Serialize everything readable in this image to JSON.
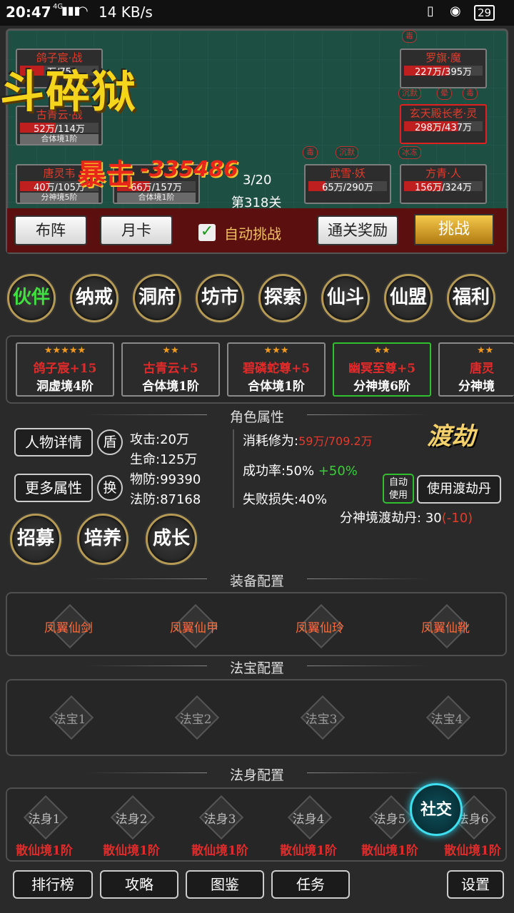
{
  "status": {
    "time": "20:47",
    "net": "4G",
    "speed": "14 KB/s",
    "battery": "29"
  },
  "battle": {
    "title": "斗碎狱",
    "crit_label": "暴击",
    "crit_value": "-335486",
    "wave": "3/20",
    "level": "第318关",
    "allies": [
      {
        "name": "鸽子宸·战",
        "hp": "万/75",
        "lv": "",
        "fill": 0.3
      },
      {
        "name": "古青云·战",
        "hp": "52万/114万",
        "lv": "合体境1阶",
        "fill": 0.45
      },
      {
        "name": "唐灵韦",
        "hp": "40万/105万",
        "lv": "分神境5阶",
        "fill": 0.38
      },
      {
        "name": "",
        "hp": "66万/157万",
        "lv": "合体境1阶",
        "fill": 0.42
      }
    ],
    "enemies": [
      {
        "name": "罗旗·魔",
        "hp": "227万/395万",
        "lv": "",
        "fill": 0.57
      },
      {
        "name": "玄天殿长老·灵",
        "hp": "298万/437万",
        "lv": "",
        "fill": 0.68
      },
      {
        "name": "武雪·妖",
        "hp": "65万/290万",
        "lv": "",
        "fill": 0.22
      },
      {
        "name": "方青·人",
        "hp": "156万/324万",
        "lv": "",
        "fill": 0.48
      }
    ],
    "tags": {
      "poison": "毒",
      "silence": "沉默",
      "stun": "晕",
      "freeze": "冰冻"
    }
  },
  "controls": {
    "formation": "布阵",
    "monthly": "月卡",
    "auto_label": "自动挑战",
    "clear_reward": "通关奖励",
    "challenge": "挑战"
  },
  "nav": [
    "伙伴",
    "纳戒",
    "洞府",
    "坊市",
    "探索",
    "仙斗",
    "仙盟",
    "福利"
  ],
  "partners": [
    {
      "stars": "★★★★★",
      "name": "鸽子宸+15",
      "level": "洞虚境4阶"
    },
    {
      "stars": "★★",
      "name": "古青云+5",
      "level": "合体境1阶"
    },
    {
      "stars": "★★★",
      "name": "碧磷蛇尊+5",
      "level": "合体境1阶"
    },
    {
      "stars": "★★",
      "name": "幽冥至尊+5",
      "level": "分神境6阶"
    },
    {
      "stars": "★★",
      "name": "唐灵",
      "level": "分神境"
    }
  ],
  "attrs": {
    "title": "角色属性",
    "detail_btn": "人物详情",
    "shield_btn": "盾",
    "more_btn": "更多属性",
    "swap_btn": "换",
    "atk": "攻击:20万",
    "hp": "生命:125万",
    "pdef": "物防:99390",
    "mdef": "法防:87168",
    "cost_label": "消耗修为:",
    "cost_value": "59万/709.2万",
    "rate_label": "成功率:50%",
    "rate_bonus": "+50%",
    "fail": "失败损失:40%",
    "auto_use": "自动使用",
    "use_pill": "使用渡劫丹",
    "pill_label": "分神境渡劫丹:",
    "pill_count": "30",
    "pill_delta": "(-10)",
    "dujie": "渡劫"
  },
  "actions": [
    "招募",
    "培养",
    "成长"
  ],
  "equip": {
    "title": "装备配置",
    "items": [
      "凤翼仙剑",
      "凤翼仙甲",
      "凤翼仙玲",
      "凤翼仙靴"
    ]
  },
  "treasure": {
    "title": "法宝配置",
    "items": [
      "法宝1",
      "法宝2",
      "法宝3",
      "法宝4"
    ]
  },
  "body": {
    "title": "法身配置",
    "items": [
      "法身1",
      "法身2",
      "法身3",
      "法身4",
      "法身5",
      "法身6"
    ],
    "levels": [
      "散仙境1阶",
      "散仙境1阶",
      "散仙境1阶",
      "散仙境1阶",
      "散仙境1阶",
      "散仙境1阶"
    ]
  },
  "social": "社交",
  "bottom": [
    "排行榜",
    "攻略",
    "图鉴",
    "任务",
    "设置"
  ],
  "colors": {
    "accent_red": "#e23b2b",
    "gold": "#d9a52b",
    "green": "#37d037"
  }
}
